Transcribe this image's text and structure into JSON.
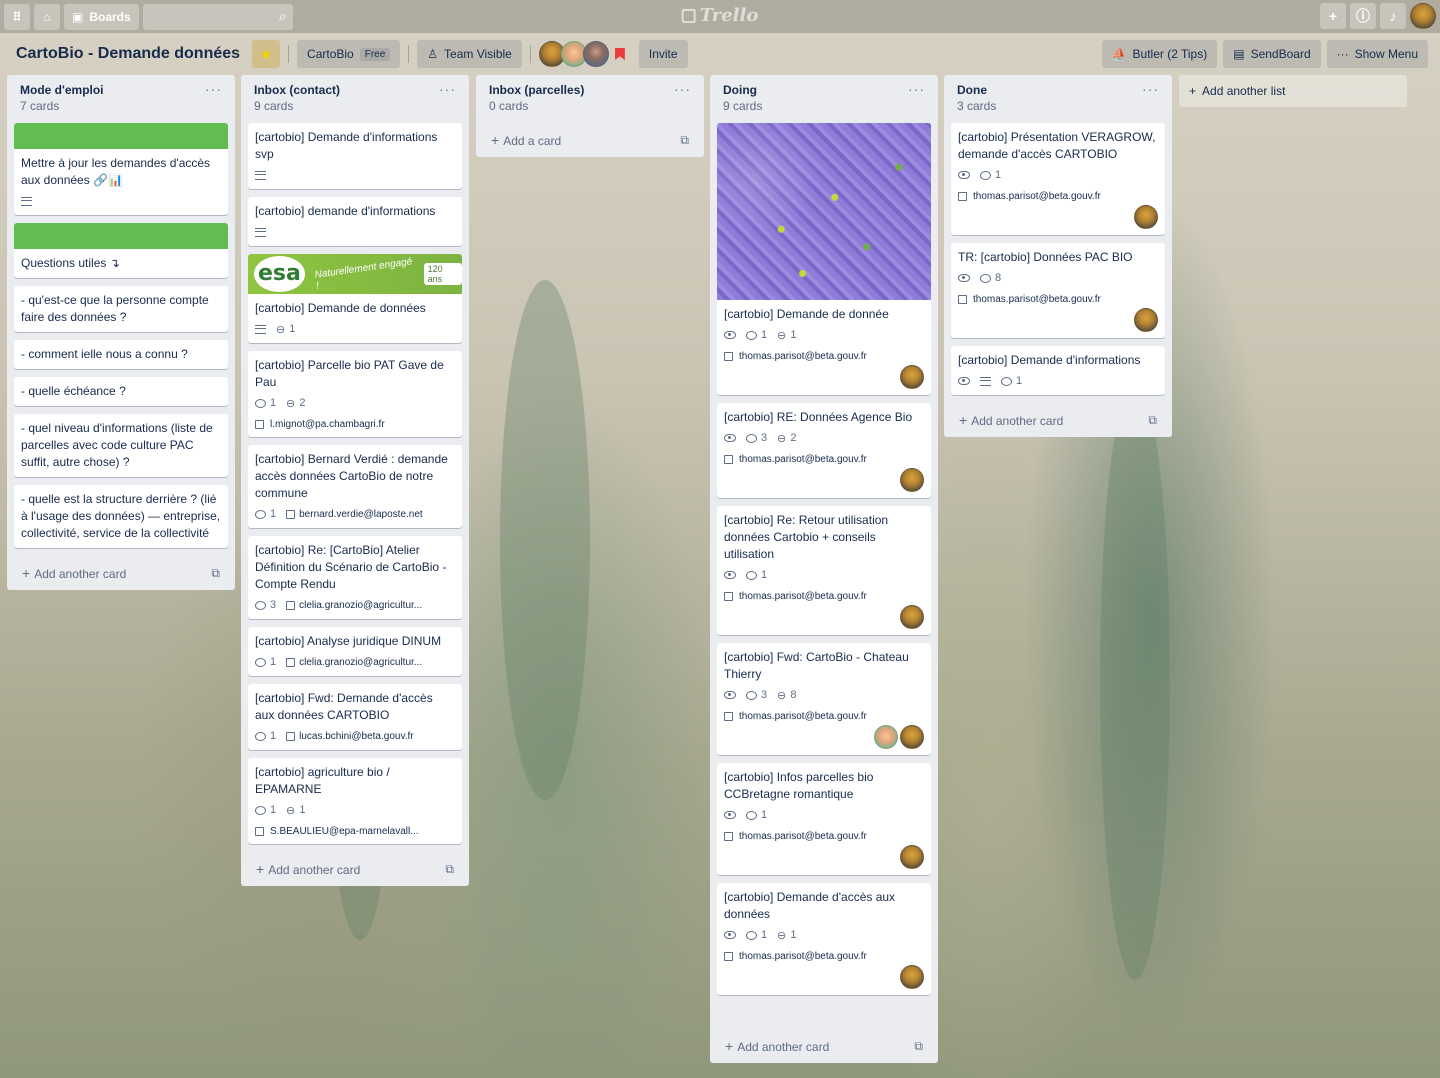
{
  "topbar": {
    "boards_label": "Boards",
    "logo": "Trello"
  },
  "board": {
    "name": "CartoBio - Demande données",
    "team_name": "CartoBio",
    "team_badge": "Free",
    "visibility": "Team Visible",
    "invite": "Invite",
    "butler": "Butler (2 Tips)",
    "sendboard": "SendBoard",
    "show_menu": "Show Menu",
    "add_list": "Add another list"
  },
  "lists": [
    {
      "title": "Mode d'emploi",
      "count": "7 cards",
      "add_label": "Add another card",
      "cards": [
        {
          "title": "Mettre à jour les demandes d'accès aux données 🔗📊"
        },
        {
          "title": "Questions utiles ↴"
        },
        {
          "title": "- qu'est-ce que la personne compte faire des données ?"
        },
        {
          "title": "- comment ielle nous a connu ?"
        },
        {
          "title": "- quelle échéance ?"
        },
        {
          "title": "- quel niveau d'informations (liste de parcelles avec code culture PAC suffit, autre chose) ?"
        },
        {
          "title": "- quelle est la structure derrière ? (lié à l'usage des données) — entreprise, collectivité, service de la collectivité"
        }
      ]
    },
    {
      "title": "Inbox (contact)",
      "count": "9 cards",
      "add_label": "Add another card",
      "cards": [
        {
          "title": "[cartobio] Demande d'informations svp"
        },
        {
          "title": "[cartobio] demande d'informations"
        },
        {
          "title": "[cartobio] Demande de données",
          "attachments": "1",
          "cover_text": "esa",
          "cover_tag": "Naturellement engagé !",
          "cover_num": "120 ans"
        },
        {
          "title": "[cartobio] Parcelle bio PAT Gave de Pau",
          "comments": "1",
          "attachments": "2",
          "email": "l.mignot@pa.chambagri.fr"
        },
        {
          "title": "[cartobio] Bernard Verdié : demande accès données CartoBio de notre commune",
          "comments": "1",
          "email": "bernard.verdie@laposte.net"
        },
        {
          "title": "[cartobio] Re: [CartoBio] Atelier Définition du Scénario de CartoBio - Compte Rendu",
          "comments": "3",
          "email": "clelia.granozio@agricultur..."
        },
        {
          "title": "[cartobio] Analyse juridique DINUM",
          "comments": "1",
          "email": "clelia.granozio@agricultur..."
        },
        {
          "title": "[cartobio] Fwd: Demande d'accès aux données CARTOBIO",
          "comments": "1",
          "email": "lucas.bchini@beta.gouv.fr"
        },
        {
          "title": "[cartobio] agriculture bio / EPAMARNE",
          "comments": "1",
          "attachments": "1",
          "email": "S.BEAULIEU@epa-marnelavall..."
        }
      ]
    },
    {
      "title": "Inbox (parcelles)",
      "count": "0 cards",
      "add_label": "Add a card"
    },
    {
      "title": "Doing",
      "count": "9 cards",
      "add_label": "Add another card",
      "cards": [
        {
          "title": "[cartobio] Demande de donnée",
          "comments": "1",
          "attachments": "1",
          "email": "thomas.parisot@beta.gouv.fr"
        },
        {
          "title": "[cartobio] RE: Données Agence Bio",
          "comments": "3",
          "attachments": "2",
          "email": "thomas.parisot@beta.gouv.fr"
        },
        {
          "title": "[cartobio] Re: Retour utilisation données Cartobio + conseils utilisation",
          "comments": "1",
          "email": "thomas.parisot@beta.gouv.fr"
        },
        {
          "title": "[cartobio] Fwd: CartoBio - Chateau Thierry",
          "comments": "3",
          "attachments": "8",
          "email": "thomas.parisot@beta.gouv.fr"
        },
        {
          "title": "[cartobio] Infos parcelles bio CCBretagne romantique",
          "comments": "1",
          "email": "thomas.parisot@beta.gouv.fr"
        },
        {
          "title": "[cartobio] Demande d'accès aux données",
          "comments": "1",
          "attachments": "1",
          "email": "thomas.parisot@beta.gouv.fr"
        }
      ]
    },
    {
      "title": "Done",
      "count": "3 cards",
      "add_label": "Add another card",
      "cards": [
        {
          "title": "[cartobio] Présentation VERAGROW, demande d'accès CARTOBIO",
          "comments": "1",
          "email": "thomas.parisot@beta.gouv.fr"
        },
        {
          "title": "TR: [cartobio] Données PAC BIO",
          "comments": "8",
          "email": "thomas.parisot@beta.gouv.fr"
        },
        {
          "title": "[cartobio] Demande d'informations",
          "comments": "1"
        }
      ]
    }
  ],
  "colors": {
    "label_green": "#61bd4f",
    "list_bg": "#ebecf0",
    "text": "#172b4d"
  }
}
